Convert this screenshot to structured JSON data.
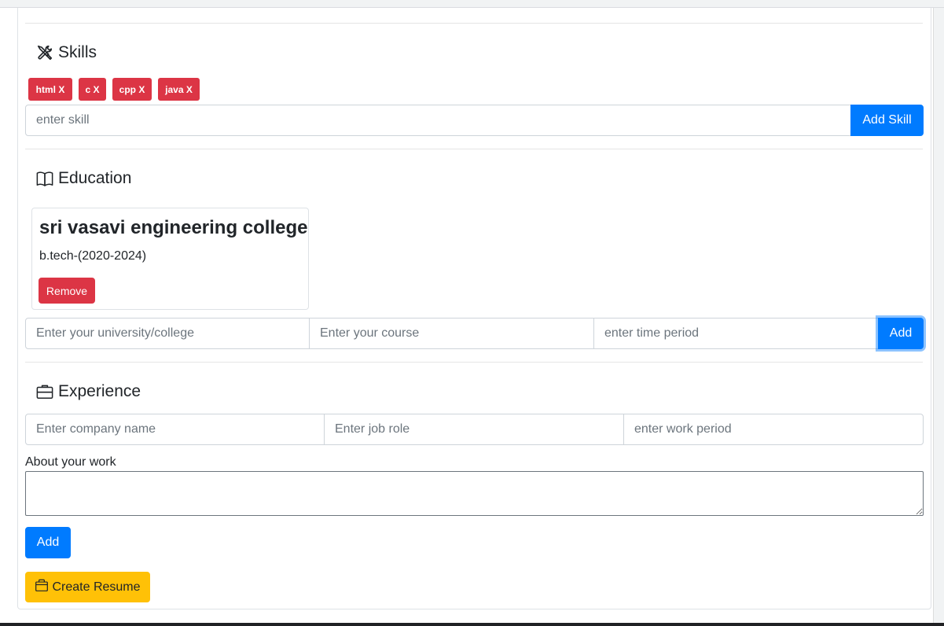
{
  "skills": {
    "title": "Skills",
    "icon": "tools-icon",
    "badges": [
      "html X",
      "c X",
      "cpp X",
      "java X"
    ],
    "input_placeholder": "enter skill",
    "add_label": "Add Skill"
  },
  "education": {
    "title": "Education",
    "icon": "book-icon",
    "entries": [
      {
        "school": "sri vasavi engineering college",
        "detail": "b.tech-(2020-2024)",
        "remove_label": "Remove"
      }
    ],
    "university_placeholder": "Enter your university/college",
    "course_placeholder": "Enter your course",
    "period_placeholder": "enter time period",
    "add_label": "Add"
  },
  "experience": {
    "title": "Experience",
    "icon": "briefcase-icon",
    "company_placeholder": "Enter company name",
    "role_placeholder": "Enter job role",
    "period_placeholder": "enter work period",
    "about_label": "About your work",
    "add_label": "Add"
  },
  "create_resume": {
    "label": "Create Resume",
    "icon": "bag-icon"
  },
  "colors": {
    "primary": "#007bff",
    "danger": "#dc3545",
    "warning": "#ffc107"
  }
}
